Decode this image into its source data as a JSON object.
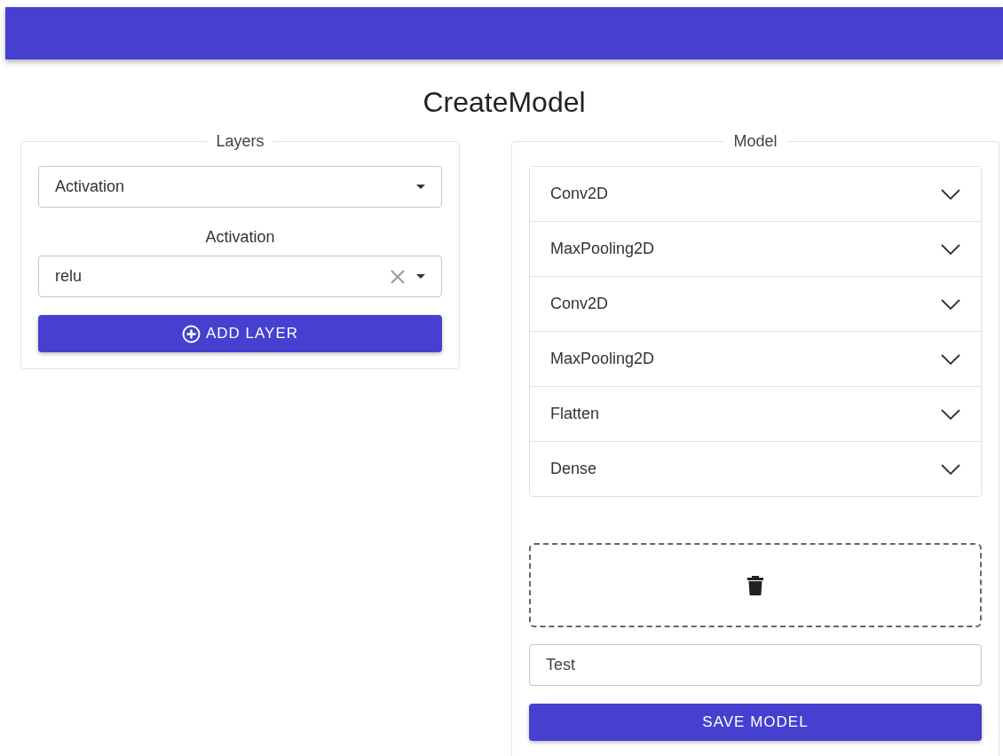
{
  "title": "CreateModel",
  "layers_panel": {
    "legend": "Layers",
    "layer_type_select": {
      "value": "Activation"
    },
    "activation_label": "Activation",
    "activation_select": {
      "value": "relu"
    },
    "add_button": "ADD LAYER"
  },
  "model_panel": {
    "legend": "Model",
    "layers": [
      {
        "name": "Conv2D",
        "expanded": false
      },
      {
        "name": "MaxPooling2D",
        "expanded": false
      },
      {
        "name": "Conv2D",
        "expanded": false
      },
      {
        "name": "MaxPooling2D",
        "expanded": false
      },
      {
        "name": "Flatten",
        "expanded": false
      },
      {
        "name": "Dense",
        "expanded": false
      }
    ],
    "model_name_field": {
      "value": "Test"
    },
    "save_button": "SAVE MODEL"
  }
}
